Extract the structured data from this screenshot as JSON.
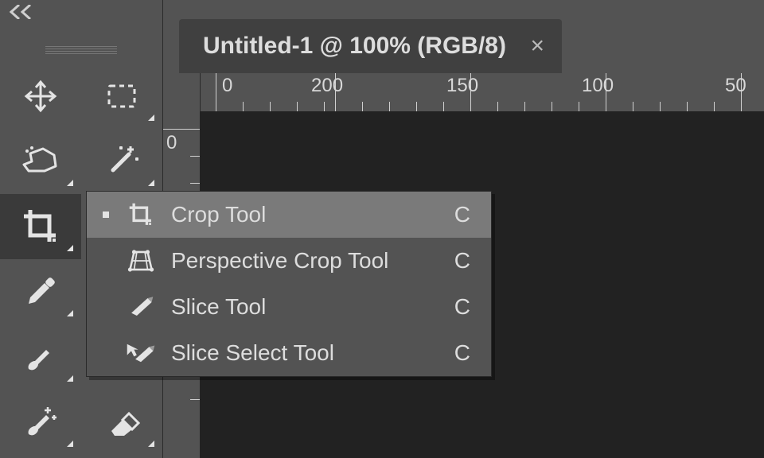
{
  "tab": {
    "title": "Untitled-1 @ 100% (RGB/8)",
    "close_glyph": "×"
  },
  "ruler": {
    "h_labels": [
      "0",
      "200",
      "150",
      "100",
      "50"
    ],
    "v_labels": [
      "0"
    ]
  },
  "flyout": {
    "rows": [
      {
        "label": "Crop Tool",
        "shortcut": "C",
        "active": true
      },
      {
        "label": "Perspective Crop Tool",
        "shortcut": "C",
        "active": false
      },
      {
        "label": "Slice Tool",
        "shortcut": "C",
        "active": false
      },
      {
        "label": "Slice Select Tool",
        "shortcut": "C",
        "active": false
      }
    ]
  }
}
